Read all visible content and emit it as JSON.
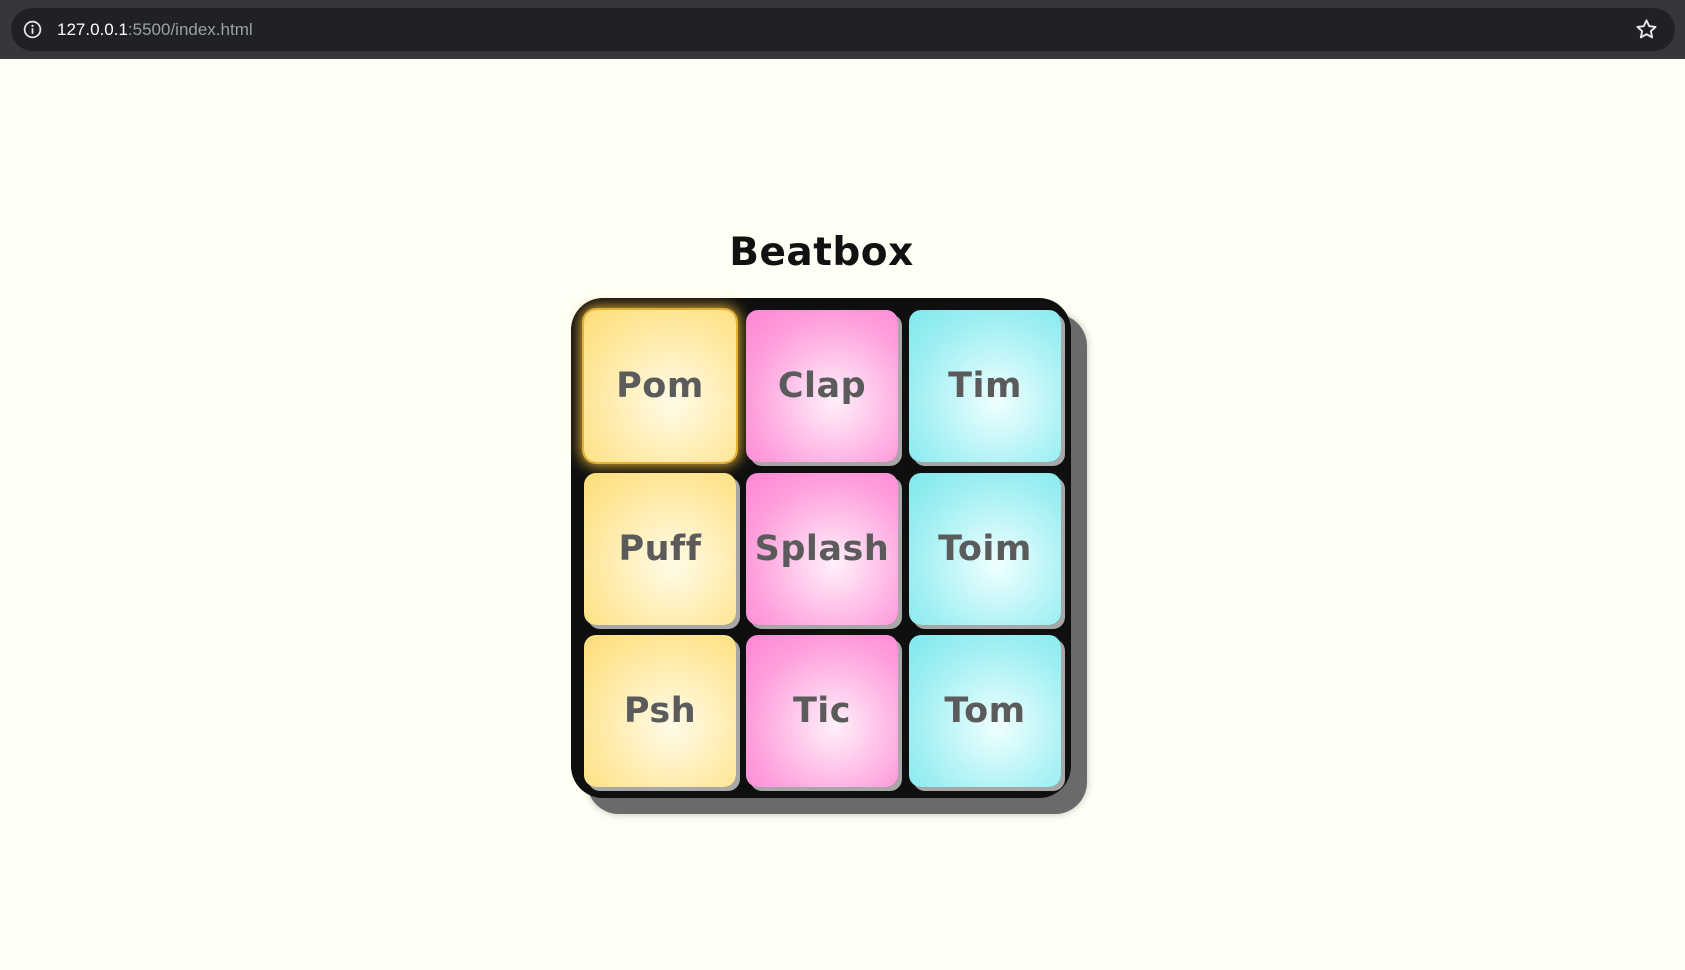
{
  "browser": {
    "url_host": "127.0.0.1",
    "url_path": ":5500/index.html",
    "info_icon": "info-icon",
    "bookmark_icon": "star-icon"
  },
  "page": {
    "title": "Beatbox"
  },
  "pads": [
    {
      "label": "Pom",
      "color": "#fedd78",
      "active": true
    },
    {
      "label": "Clap",
      "color": "#ff85d3",
      "active": false
    },
    {
      "label": "Tim",
      "color": "#7ee8ec",
      "active": false
    },
    {
      "label": "Puff",
      "color": "#fedd78",
      "active": false
    },
    {
      "label": "Splash",
      "color": "#ff85d3",
      "active": false
    },
    {
      "label": "Toim",
      "color": "#7ee8ec",
      "active": false
    },
    {
      "label": "Psh",
      "color": "#fedd78",
      "active": false
    },
    {
      "label": "Tic",
      "color": "#ff85d3",
      "active": false
    },
    {
      "label": "Tom",
      "color": "#7ee8ec",
      "active": false
    }
  ],
  "colors": {
    "page_background": "#fffff5",
    "board": "#0f0f10",
    "board_shadow": "#6a6a6a",
    "pad_text": "#5b5b5b"
  }
}
